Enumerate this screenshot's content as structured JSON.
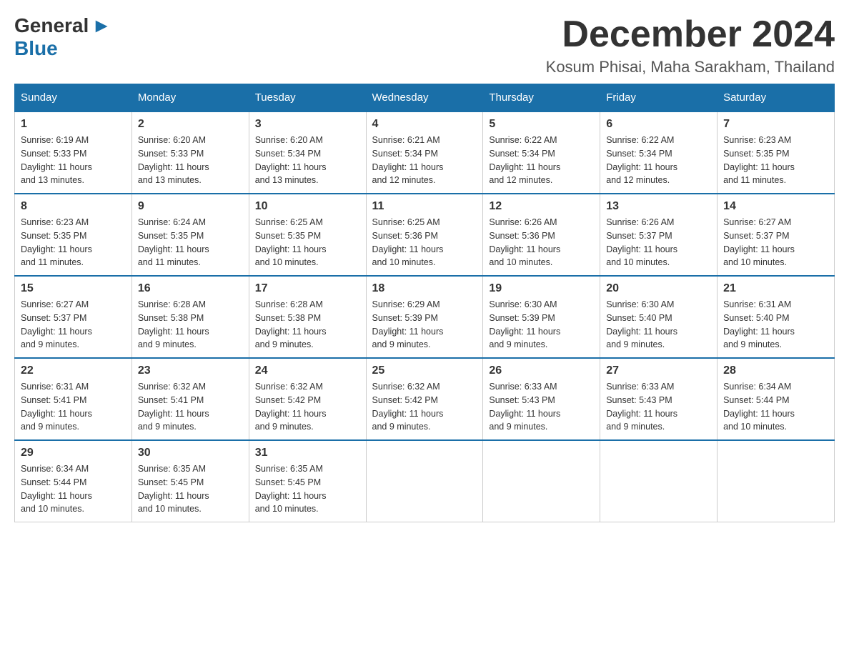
{
  "header": {
    "logo_general": "General",
    "logo_blue": "Blue",
    "month_title": "December 2024",
    "location": "Kosum Phisai, Maha Sarakham, Thailand"
  },
  "weekdays": [
    "Sunday",
    "Monday",
    "Tuesday",
    "Wednesday",
    "Thursday",
    "Friday",
    "Saturday"
  ],
  "weeks": [
    [
      {
        "day": "1",
        "sunrise": "6:19 AM",
        "sunset": "5:33 PM",
        "daylight": "11 hours and 13 minutes."
      },
      {
        "day": "2",
        "sunrise": "6:20 AM",
        "sunset": "5:33 PM",
        "daylight": "11 hours and 13 minutes."
      },
      {
        "day": "3",
        "sunrise": "6:20 AM",
        "sunset": "5:34 PM",
        "daylight": "11 hours and 13 minutes."
      },
      {
        "day": "4",
        "sunrise": "6:21 AM",
        "sunset": "5:34 PM",
        "daylight": "11 hours and 12 minutes."
      },
      {
        "day": "5",
        "sunrise": "6:22 AM",
        "sunset": "5:34 PM",
        "daylight": "11 hours and 12 minutes."
      },
      {
        "day": "6",
        "sunrise": "6:22 AM",
        "sunset": "5:34 PM",
        "daylight": "11 hours and 12 minutes."
      },
      {
        "day": "7",
        "sunrise": "6:23 AM",
        "sunset": "5:35 PM",
        "daylight": "11 hours and 11 minutes."
      }
    ],
    [
      {
        "day": "8",
        "sunrise": "6:23 AM",
        "sunset": "5:35 PM",
        "daylight": "11 hours and 11 minutes."
      },
      {
        "day": "9",
        "sunrise": "6:24 AM",
        "sunset": "5:35 PM",
        "daylight": "11 hours and 11 minutes."
      },
      {
        "day": "10",
        "sunrise": "6:25 AM",
        "sunset": "5:35 PM",
        "daylight": "11 hours and 10 minutes."
      },
      {
        "day": "11",
        "sunrise": "6:25 AM",
        "sunset": "5:36 PM",
        "daylight": "11 hours and 10 minutes."
      },
      {
        "day": "12",
        "sunrise": "6:26 AM",
        "sunset": "5:36 PM",
        "daylight": "11 hours and 10 minutes."
      },
      {
        "day": "13",
        "sunrise": "6:26 AM",
        "sunset": "5:37 PM",
        "daylight": "11 hours and 10 minutes."
      },
      {
        "day": "14",
        "sunrise": "6:27 AM",
        "sunset": "5:37 PM",
        "daylight": "11 hours and 10 minutes."
      }
    ],
    [
      {
        "day": "15",
        "sunrise": "6:27 AM",
        "sunset": "5:37 PM",
        "daylight": "11 hours and 9 minutes."
      },
      {
        "day": "16",
        "sunrise": "6:28 AM",
        "sunset": "5:38 PM",
        "daylight": "11 hours and 9 minutes."
      },
      {
        "day": "17",
        "sunrise": "6:28 AM",
        "sunset": "5:38 PM",
        "daylight": "11 hours and 9 minutes."
      },
      {
        "day": "18",
        "sunrise": "6:29 AM",
        "sunset": "5:39 PM",
        "daylight": "11 hours and 9 minutes."
      },
      {
        "day": "19",
        "sunrise": "6:30 AM",
        "sunset": "5:39 PM",
        "daylight": "11 hours and 9 minutes."
      },
      {
        "day": "20",
        "sunrise": "6:30 AM",
        "sunset": "5:40 PM",
        "daylight": "11 hours and 9 minutes."
      },
      {
        "day": "21",
        "sunrise": "6:31 AM",
        "sunset": "5:40 PM",
        "daylight": "11 hours and 9 minutes."
      }
    ],
    [
      {
        "day": "22",
        "sunrise": "6:31 AM",
        "sunset": "5:41 PM",
        "daylight": "11 hours and 9 minutes."
      },
      {
        "day": "23",
        "sunrise": "6:32 AM",
        "sunset": "5:41 PM",
        "daylight": "11 hours and 9 minutes."
      },
      {
        "day": "24",
        "sunrise": "6:32 AM",
        "sunset": "5:42 PM",
        "daylight": "11 hours and 9 minutes."
      },
      {
        "day": "25",
        "sunrise": "6:32 AM",
        "sunset": "5:42 PM",
        "daylight": "11 hours and 9 minutes."
      },
      {
        "day": "26",
        "sunrise": "6:33 AM",
        "sunset": "5:43 PM",
        "daylight": "11 hours and 9 minutes."
      },
      {
        "day": "27",
        "sunrise": "6:33 AM",
        "sunset": "5:43 PM",
        "daylight": "11 hours and 9 minutes."
      },
      {
        "day": "28",
        "sunrise": "6:34 AM",
        "sunset": "5:44 PM",
        "daylight": "11 hours and 10 minutes."
      }
    ],
    [
      {
        "day": "29",
        "sunrise": "6:34 AM",
        "sunset": "5:44 PM",
        "daylight": "11 hours and 10 minutes."
      },
      {
        "day": "30",
        "sunrise": "6:35 AM",
        "sunset": "5:45 PM",
        "daylight": "11 hours and 10 minutes."
      },
      {
        "day": "31",
        "sunrise": "6:35 AM",
        "sunset": "5:45 PM",
        "daylight": "11 hours and 10 minutes."
      },
      null,
      null,
      null,
      null
    ]
  ],
  "labels": {
    "sunrise": "Sunrise:",
    "sunset": "Sunset:",
    "daylight": "Daylight:"
  }
}
